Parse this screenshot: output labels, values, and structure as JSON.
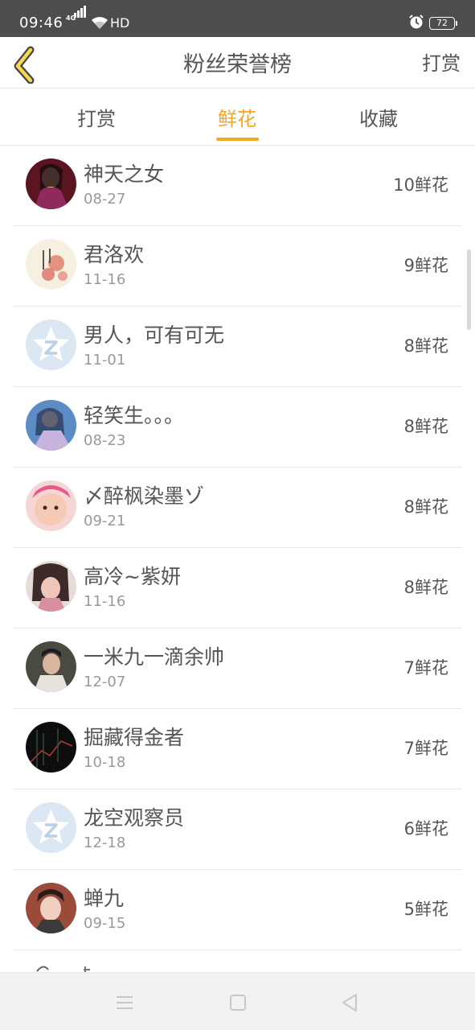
{
  "status_bar": {
    "time": "09:46",
    "network": "4G",
    "hd": "HD",
    "battery": "72"
  },
  "header": {
    "title": "粉丝荣誉榜",
    "action": "打赏"
  },
  "tabs": [
    {
      "label": "打赏",
      "active": false
    },
    {
      "label": "鲜花",
      "active": true
    },
    {
      "label": "收藏",
      "active": false
    }
  ],
  "colors": {
    "accent": "#f5a623",
    "status_bar": "#4d4d4d"
  },
  "fans": [
    {
      "name": "神天之女",
      "date": "08-27",
      "count": "10鲜花"
    },
    {
      "name": "君洛欢",
      "date": "11-16",
      "count": "9鲜花"
    },
    {
      "name": "男人，可有可无",
      "date": "11-01",
      "count": "8鲜花"
    },
    {
      "name": "轻笑生。。。",
      "date": "08-23",
      "count": "8鲜花"
    },
    {
      "name": "〆醉枫染墨ゾ",
      "date": "09-21",
      "count": "8鲜花"
    },
    {
      "name": "高冷~紫妍",
      "date": "11-16",
      "count": "8鲜花"
    },
    {
      "name": "一米九一滴余帅",
      "date": "12-07",
      "count": "7鲜花"
    },
    {
      "name": "掘藏得金者",
      "date": "10-18",
      "count": "7鲜花"
    },
    {
      "name": "龙空观察员",
      "date": "12-18",
      "count": "6鲜花"
    },
    {
      "name": "蝉九",
      "date": "09-15",
      "count": "5鲜花"
    }
  ]
}
